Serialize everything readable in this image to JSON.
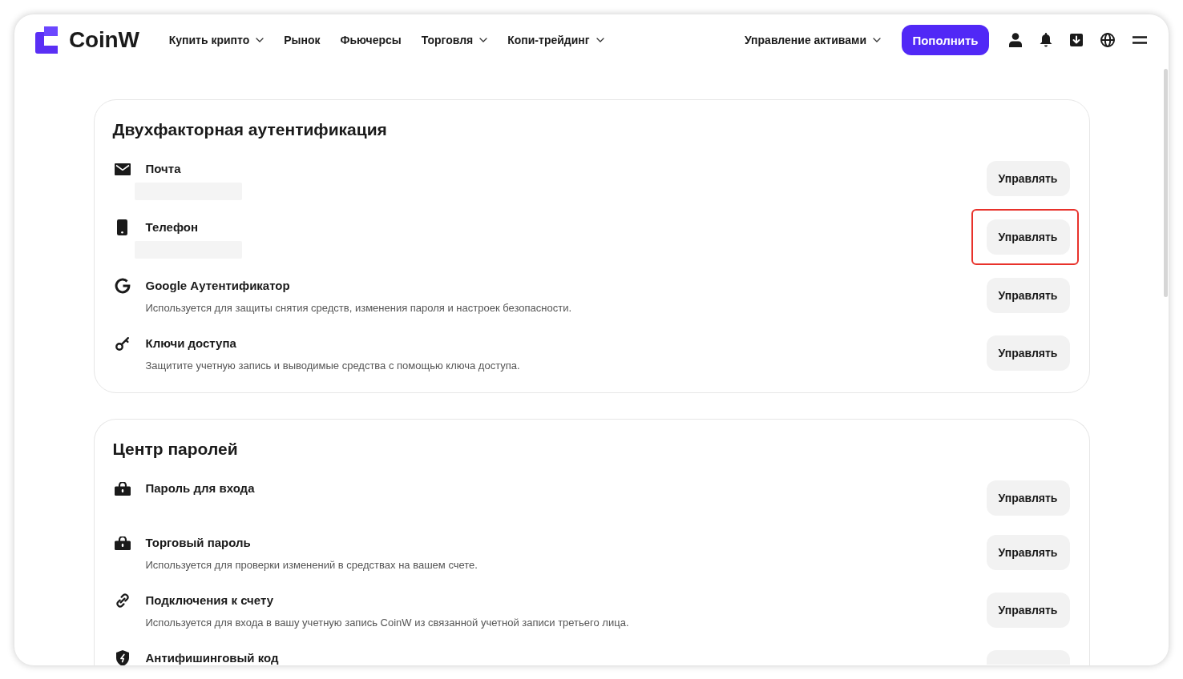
{
  "header": {
    "logo": "CoinW",
    "nav": [
      {
        "label": "Купить крипто",
        "dropdown": true
      },
      {
        "label": "Рынок",
        "dropdown": false
      },
      {
        "label": "Фьючерсы",
        "dropdown": false
      },
      {
        "label": "Торговля",
        "dropdown": true
      },
      {
        "label": "Копи-трейдинг",
        "dropdown": true
      }
    ],
    "assets_menu": {
      "label": "Управление активами",
      "dropdown": true
    },
    "deposit_button": "Пополнить"
  },
  "sections": [
    {
      "title": "Двухфакторная аутентификация",
      "items": [
        {
          "kind": "mail",
          "title": "Почта",
          "value_hidden": true,
          "button": "Управлять",
          "button_clipped": false,
          "highlighted": false
        },
        {
          "kind": "phone",
          "title": "Телефон",
          "value_hidden": true,
          "button": "Управлять",
          "button_clipped": false,
          "highlighted": true
        },
        {
          "kind": "authenticator",
          "title": "Google Аутентификатор",
          "description": "Используется для защиты снятия средств, изменения пароля и настроек безопасности.",
          "value_hidden": false,
          "button": "Управлять",
          "button_clipped": false,
          "highlighted": false
        },
        {
          "kind": "passkey",
          "title": "Ключи доступа",
          "description": "Защитите учетную запись и выводимые средства с помощью ключа доступа.",
          "value_hidden": false,
          "button": "Управлять",
          "button_clipped": false,
          "highlighted": false
        }
      ]
    },
    {
      "title": "Центр паролей",
      "items": [
        {
          "kind": "password",
          "title": "Пароль для входа",
          "value_hidden": false,
          "button": "Управлять",
          "button_clipped": false,
          "highlighted": false
        },
        {
          "kind": "password",
          "title": "Торговый пароль",
          "description": "Используется для проверки изменений в средствах на вашем счете.",
          "value_hidden": false,
          "button": "Управлять",
          "button_clipped": false,
          "highlighted": false
        },
        {
          "kind": "link",
          "title": "Подключения к счету",
          "description": "Используется для входа в вашу учетную запись CoinW из связанной учетной записи третьего лица.",
          "value_hidden": false,
          "button": "Управлять",
          "button_clipped": false,
          "highlighted": false
        },
        {
          "kind": "anti-phishing",
          "title": "Антифишинговый код",
          "value_hidden": false,
          "button_clipped": true,
          "highlighted": false
        }
      ]
    }
  ]
}
